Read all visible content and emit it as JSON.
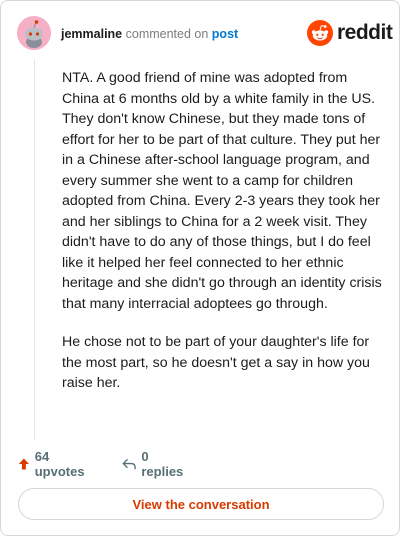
{
  "header": {
    "username": "jemmaline",
    "commented_text": "commented on",
    "post_link": "post",
    "brand": "reddit"
  },
  "comment": {
    "paragraphs": [
      "NTA. A good friend of mine was adopted from China at 6 months old by a white family in the US. They don't know Chinese, but they made tons of effort for her to be part of that culture. They put her in a Chinese after-school language program, and every summer she went to a camp for children adopted from China. Every 2-3 years they took her and her siblings to China for a 2 week visit. They didn't have to do any of those things, but I do feel like it helped her feel connected to her ethnic heritage and she didn't go through an identity crisis that many interracial adoptees go through.",
      "He chose not to be part of your daughter's life for the most part, so he doesn't get a say in how you raise her."
    ]
  },
  "actions": {
    "upvotes": "64 upvotes",
    "replies": "0 replies"
  },
  "footer": {
    "view_button": "View the conversation"
  },
  "colors": {
    "brand_orange": "#ff4500",
    "upvote_orange": "#d93a00",
    "link_blue": "#0079d3",
    "avatar_pink": "#f6b0c6"
  },
  "icons": [
    "snoo-avatar",
    "reddit-logo-icon",
    "upvote-arrow-icon",
    "reply-arrow-icon"
  ]
}
